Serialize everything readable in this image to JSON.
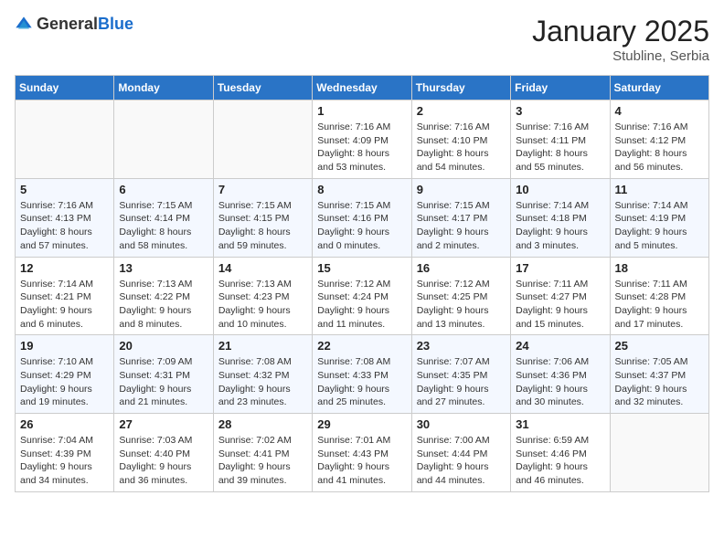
{
  "logo": {
    "general": "General",
    "blue": "Blue"
  },
  "title": "January 2025",
  "location": "Stubline, Serbia",
  "weekdays": [
    "Sunday",
    "Monday",
    "Tuesday",
    "Wednesday",
    "Thursday",
    "Friday",
    "Saturday"
  ],
  "weeks": [
    [
      {
        "day": "",
        "info": ""
      },
      {
        "day": "",
        "info": ""
      },
      {
        "day": "",
        "info": ""
      },
      {
        "day": "1",
        "info": "Sunrise: 7:16 AM\nSunset: 4:09 PM\nDaylight: 8 hours and 53 minutes."
      },
      {
        "day": "2",
        "info": "Sunrise: 7:16 AM\nSunset: 4:10 PM\nDaylight: 8 hours and 54 minutes."
      },
      {
        "day": "3",
        "info": "Sunrise: 7:16 AM\nSunset: 4:11 PM\nDaylight: 8 hours and 55 minutes."
      },
      {
        "day": "4",
        "info": "Sunrise: 7:16 AM\nSunset: 4:12 PM\nDaylight: 8 hours and 56 minutes."
      }
    ],
    [
      {
        "day": "5",
        "info": "Sunrise: 7:16 AM\nSunset: 4:13 PM\nDaylight: 8 hours and 57 minutes."
      },
      {
        "day": "6",
        "info": "Sunrise: 7:15 AM\nSunset: 4:14 PM\nDaylight: 8 hours and 58 minutes."
      },
      {
        "day": "7",
        "info": "Sunrise: 7:15 AM\nSunset: 4:15 PM\nDaylight: 8 hours and 59 minutes."
      },
      {
        "day": "8",
        "info": "Sunrise: 7:15 AM\nSunset: 4:16 PM\nDaylight: 9 hours and 0 minutes."
      },
      {
        "day": "9",
        "info": "Sunrise: 7:15 AM\nSunset: 4:17 PM\nDaylight: 9 hours and 2 minutes."
      },
      {
        "day": "10",
        "info": "Sunrise: 7:14 AM\nSunset: 4:18 PM\nDaylight: 9 hours and 3 minutes."
      },
      {
        "day": "11",
        "info": "Sunrise: 7:14 AM\nSunset: 4:19 PM\nDaylight: 9 hours and 5 minutes."
      }
    ],
    [
      {
        "day": "12",
        "info": "Sunrise: 7:14 AM\nSunset: 4:21 PM\nDaylight: 9 hours and 6 minutes."
      },
      {
        "day": "13",
        "info": "Sunrise: 7:13 AM\nSunset: 4:22 PM\nDaylight: 9 hours and 8 minutes."
      },
      {
        "day": "14",
        "info": "Sunrise: 7:13 AM\nSunset: 4:23 PM\nDaylight: 9 hours and 10 minutes."
      },
      {
        "day": "15",
        "info": "Sunrise: 7:12 AM\nSunset: 4:24 PM\nDaylight: 9 hours and 11 minutes."
      },
      {
        "day": "16",
        "info": "Sunrise: 7:12 AM\nSunset: 4:25 PM\nDaylight: 9 hours and 13 minutes."
      },
      {
        "day": "17",
        "info": "Sunrise: 7:11 AM\nSunset: 4:27 PM\nDaylight: 9 hours and 15 minutes."
      },
      {
        "day": "18",
        "info": "Sunrise: 7:11 AM\nSunset: 4:28 PM\nDaylight: 9 hours and 17 minutes."
      }
    ],
    [
      {
        "day": "19",
        "info": "Sunrise: 7:10 AM\nSunset: 4:29 PM\nDaylight: 9 hours and 19 minutes."
      },
      {
        "day": "20",
        "info": "Sunrise: 7:09 AM\nSunset: 4:31 PM\nDaylight: 9 hours and 21 minutes."
      },
      {
        "day": "21",
        "info": "Sunrise: 7:08 AM\nSunset: 4:32 PM\nDaylight: 9 hours and 23 minutes."
      },
      {
        "day": "22",
        "info": "Sunrise: 7:08 AM\nSunset: 4:33 PM\nDaylight: 9 hours and 25 minutes."
      },
      {
        "day": "23",
        "info": "Sunrise: 7:07 AM\nSunset: 4:35 PM\nDaylight: 9 hours and 27 minutes."
      },
      {
        "day": "24",
        "info": "Sunrise: 7:06 AM\nSunset: 4:36 PM\nDaylight: 9 hours and 30 minutes."
      },
      {
        "day": "25",
        "info": "Sunrise: 7:05 AM\nSunset: 4:37 PM\nDaylight: 9 hours and 32 minutes."
      }
    ],
    [
      {
        "day": "26",
        "info": "Sunrise: 7:04 AM\nSunset: 4:39 PM\nDaylight: 9 hours and 34 minutes."
      },
      {
        "day": "27",
        "info": "Sunrise: 7:03 AM\nSunset: 4:40 PM\nDaylight: 9 hours and 36 minutes."
      },
      {
        "day": "28",
        "info": "Sunrise: 7:02 AM\nSunset: 4:41 PM\nDaylight: 9 hours and 39 minutes."
      },
      {
        "day": "29",
        "info": "Sunrise: 7:01 AM\nSunset: 4:43 PM\nDaylight: 9 hours and 41 minutes."
      },
      {
        "day": "30",
        "info": "Sunrise: 7:00 AM\nSunset: 4:44 PM\nDaylight: 9 hours and 44 minutes."
      },
      {
        "day": "31",
        "info": "Sunrise: 6:59 AM\nSunset: 4:46 PM\nDaylight: 9 hours and 46 minutes."
      },
      {
        "day": "",
        "info": ""
      }
    ]
  ]
}
